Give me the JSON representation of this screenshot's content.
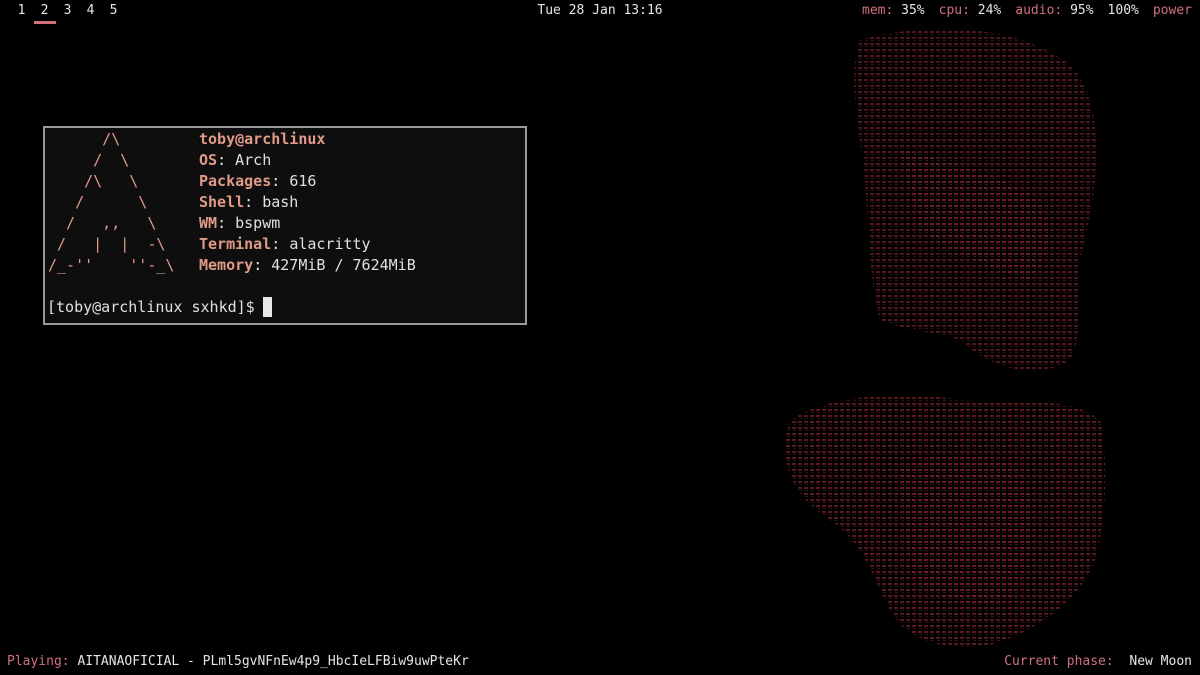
{
  "top_bar": {
    "workspaces": [
      "1",
      "2",
      "3",
      "4",
      "5"
    ],
    "active_workspace": "2",
    "clock": "Tue 28 Jan 13:16",
    "mem": {
      "label": "mem:",
      "value": "35%"
    },
    "cpu": {
      "label": "cpu:",
      "value": "24%"
    },
    "audio": {
      "label": "audio:",
      "value": "95%"
    },
    "brightness": {
      "value": "100%"
    },
    "power_label": "power"
  },
  "terminal": {
    "logo_lines": [
      "      /\\",
      "     /  \\",
      "    /\\   \\",
      "   /      \\",
      "  /   ,,   \\",
      " /   |  |  -\\",
      "/_-''    ''-_\\"
    ],
    "userhost": "toby@archlinux",
    "info": [
      {
        "key": "OS",
        "value": "Arch"
      },
      {
        "key": "Packages",
        "value": "616"
      },
      {
        "key": "Shell",
        "value": "bash"
      },
      {
        "key": "WM",
        "value": "bspwm"
      },
      {
        "key": "Terminal",
        "value": "alacritty"
      },
      {
        "key": "Memory",
        "value": "427MiB / 7624MiB"
      }
    ],
    "prompt": "[toby@archlinux sxhkd]$"
  },
  "bottom_bar": {
    "playing_label": "Playing:",
    "playing_value": "AITANAOFICIAL - PLml5gvNFnEw4p9_HbcIeLFBiw9uwPteKr",
    "phase_label": "Current phase:",
    "phase_value": "New Moon"
  },
  "colors": {
    "accent": "#d0707a",
    "logo": "#e29a88",
    "wallpaper": "#7a1e22",
    "terminal_bg": "#0e0e0e",
    "terminal_border": "#9a9a9a"
  }
}
